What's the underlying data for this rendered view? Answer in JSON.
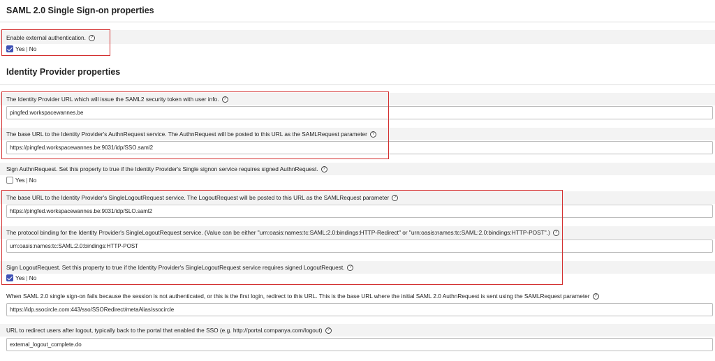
{
  "saml_section": {
    "title": "SAML 2.0 Single Sign-on properties"
  },
  "enable_external_auth": {
    "label": "Enable external authentication.",
    "yes": "Yes",
    "separator": "|",
    "no": "No",
    "checked": true
  },
  "idp_section": {
    "title": "Identity Provider properties"
  },
  "idp_url": {
    "label": "The Identity Provider URL which will issue the SAML2 security token with user info.",
    "value": "pingfed.workspacewannes.be"
  },
  "authn_request_url": {
    "label": "The base URL to the Identity Provider's AuthnRequest service. The AuthnRequest will be posted to this URL as the SAMLRequest parameter",
    "value": "https://pingfed.workspacewannes.be:9031/idp/SSO.saml2"
  },
  "sign_authn_request": {
    "label": "Sign AuthnRequest. Set this property to true if the Identity Provider's Single signon service requires signed AuthnRequest.",
    "yes": "Yes",
    "separator": "|",
    "no": "No",
    "checked": false
  },
  "logout_request_url": {
    "label": "The base URL to the Identity Provider's SingleLogoutRequest service. The LogoutRequest will be posted to this URL as the SAMLRequest parameter",
    "value": "https://pingfed.workspacewannes.be:9031/idp/SLO.saml2"
  },
  "protocol_binding": {
    "label": "The protocol binding for the Identity Provider's SingleLogoutRequest service. (Value can be either \"urn:oasis:names:tc:SAML:2.0:bindings:HTTP-Redirect\" or \"urn:oasis:names:tc:SAML:2.0:bindings:HTTP-POST\".)",
    "value": "urn:oasis:names:tc:SAML:2.0:bindings:HTTP-POST"
  },
  "sign_logout_request": {
    "label": "Sign LogoutRequest. Set this property to true if the Identity Provider's SingleLogoutRequest service requires signed LogoutRequest.",
    "yes": "Yes",
    "separator": "|",
    "no": "No",
    "checked": true
  },
  "sso_fail_redirect": {
    "label": "When SAML 2.0 single sign-on fails because the session is not authenticated, or this is the first login, redirect to this URL. This is the base URL where the initial SAML 2.0 AuthnRequest is sent using the SAMLRequest parameter",
    "value": "https://idp.ssocircle.com:443/sso/SSORedirect/metaAlias/ssocircle"
  },
  "logout_redirect": {
    "label": "URL to redirect users after logout, typically back to the portal that enabled the SSO (e.g. http://portal.companya.com/logout)",
    "value": "external_logout_complete.do"
  },
  "colors": {
    "highlight": "#d32f2f",
    "checkbox_checked": "#3f51b5",
    "row_shade": "#f3f3f3"
  }
}
